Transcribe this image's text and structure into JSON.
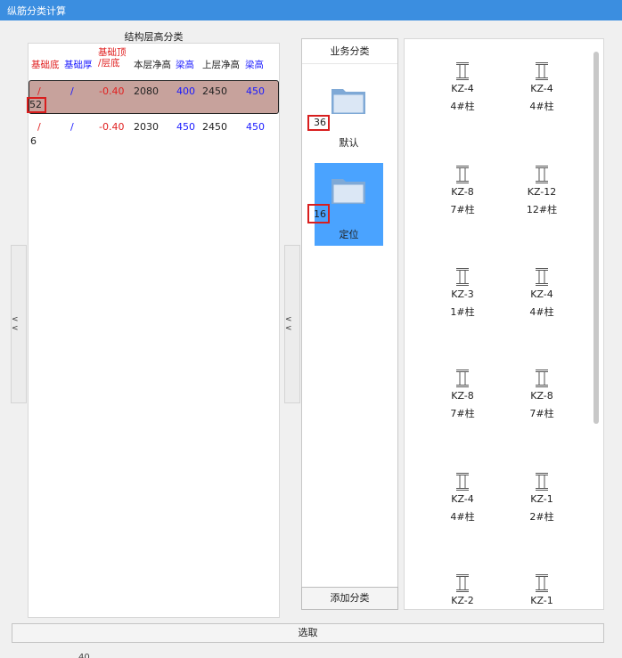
{
  "window": {
    "title": "纵筋分类计算"
  },
  "structure_panel": {
    "title": "结构层高分类",
    "headers": [
      {
        "label": "基础底",
        "color": "#e02020"
      },
      {
        "label": "基础厚",
        "color": "#1a1aff"
      },
      {
        "label": "基础顶\n/层底",
        "color": "#e02020"
      },
      {
        "label": "本层净高",
        "color": "#222222"
      },
      {
        "label": "梁高",
        "color": "#1a1aff"
      },
      {
        "label": "上层净高",
        "color": "#222222"
      },
      {
        "label": "梁高",
        "color": "#1a1aff"
      }
    ],
    "rows": [
      {
        "cells": [
          "/",
          "/",
          "-0.40",
          "2080",
          "400",
          "2450",
          "450"
        ],
        "count": "52",
        "selected": true
      },
      {
        "cells": [
          "/",
          "/",
          "-0.40",
          "2030",
          "450",
          "2450",
          "450"
        ],
        "count": "6",
        "selected": false
      }
    ],
    "collapse_label": "< <"
  },
  "business_panel": {
    "title": "业务分类",
    "categories": [
      {
        "label": "默认",
        "count": "36",
        "selected": false
      },
      {
        "label": "定位",
        "count": "16",
        "selected": true
      }
    ],
    "add_label": "添加分类",
    "collapse_label": "< <"
  },
  "icon_panel": {
    "items": [
      {
        "code": "KZ-4",
        "name": "4#柱"
      },
      {
        "code": "KZ-4",
        "name": "4#柱"
      },
      {
        "code": "KZ-8",
        "name": "7#柱"
      },
      {
        "code": "KZ-12",
        "name": "12#柱"
      },
      {
        "code": "KZ-3",
        "name": "1#柱"
      },
      {
        "code": "KZ-4",
        "name": "4#柱"
      },
      {
        "code": "KZ-8",
        "name": "7#柱"
      },
      {
        "code": "KZ-8",
        "name": "7#柱"
      },
      {
        "code": "KZ-4",
        "name": "4#柱"
      },
      {
        "code": "KZ-1",
        "name": "2#柱"
      },
      {
        "code": "KZ-2",
        "name": ""
      },
      {
        "code": "KZ-1",
        "name": ""
      }
    ]
  },
  "footer": {
    "select_label": "选取",
    "page_number": "40"
  },
  "colors": {
    "accent": "#3b8ee0",
    "selected_row": "#c7a29c",
    "selected_tile": "#4aa3ff",
    "highlight_box": "#d81e1e"
  }
}
